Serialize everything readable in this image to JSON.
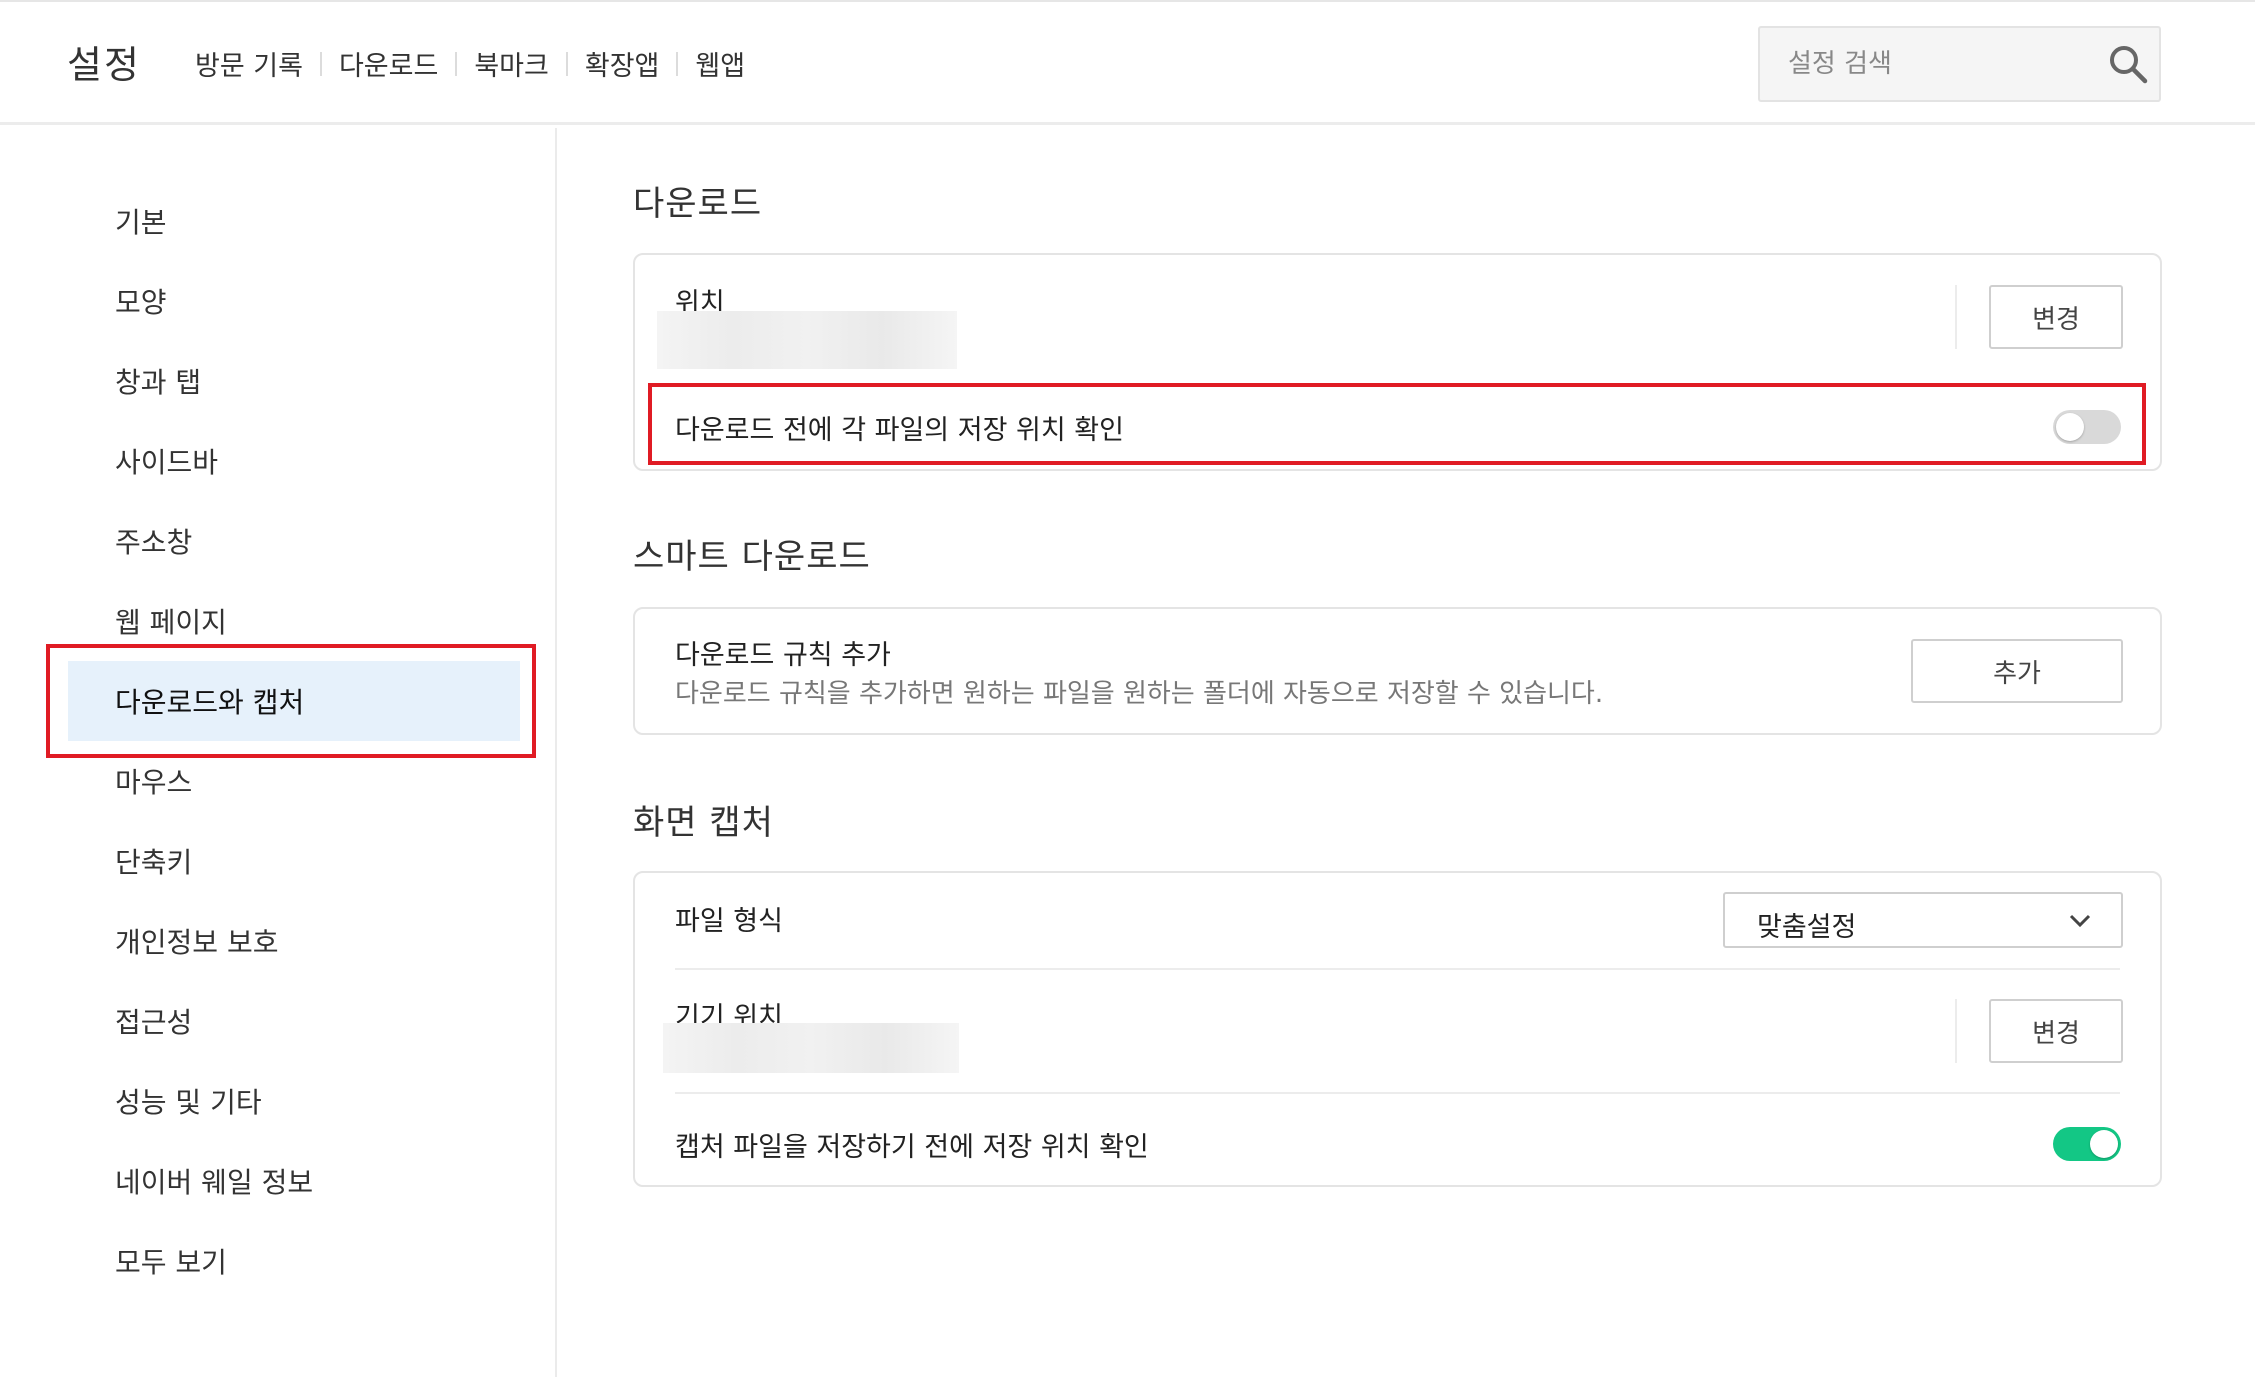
{
  "header": {
    "title": "설정",
    "nav": [
      "방문 기록",
      "다운로드",
      "북마크",
      "확장앱",
      "웹앱"
    ],
    "search_placeholder": "설정 검색",
    "search_icon": "search-icon"
  },
  "sidebar": {
    "items": [
      {
        "label": "기본"
      },
      {
        "label": "모양"
      },
      {
        "label": "창과 탭"
      },
      {
        "label": "사이드바"
      },
      {
        "label": "주소창"
      },
      {
        "label": "웹 페이지"
      },
      {
        "label": "다운로드와 캡처",
        "active": true
      },
      {
        "label": "마우스"
      },
      {
        "label": "단축키"
      },
      {
        "label": "개인정보 보호"
      },
      {
        "label": "접근성"
      },
      {
        "label": "성능 및 기타"
      },
      {
        "label": "네이버 웨일 정보"
      },
      {
        "label": "모두 보기"
      }
    ]
  },
  "download": {
    "title": "다운로드",
    "location_label": "위치",
    "change_label": "변경",
    "ask_label": "다운로드 전에 각 파일의 저장 위치 확인",
    "ask_on": false
  },
  "smart": {
    "title": "스마트 다운로드",
    "rule_label": "다운로드 규칙 추가",
    "rule_desc": "다운로드 규칙을 추가하면 원하는 파일을 원하는 폴더에 자동으로 저장할 수 있습니다.",
    "add_label": "추가"
  },
  "capture": {
    "title": "화면 캡처",
    "format_label": "파일 형식",
    "format_value": "맞춤설정",
    "location_label": "기기 위치",
    "change_label": "변경",
    "ask_label": "캡처 파일을 저장하기 전에 저장 위치 확인",
    "ask_on": true
  },
  "colors": {
    "highlight": "#e01b24",
    "toggle_on": "#13c785",
    "toggle_off": "#d9d9d9",
    "active_bg": "#e6f1fb"
  }
}
